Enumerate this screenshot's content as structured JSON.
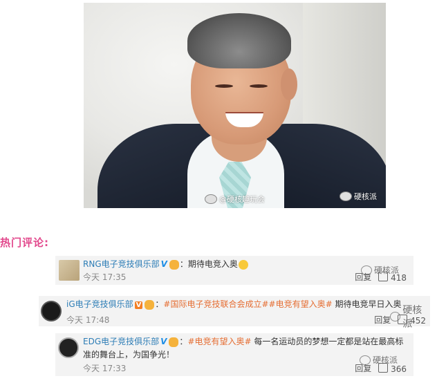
{
  "photo": {
    "watermark_left": "@硬核趣玩会",
    "watermark_right": "硬核派"
  },
  "section_title": "热门评论:",
  "comments": [
    {
      "author": "RNG电子竞技俱乐部",
      "badge": "V",
      "text": "：期待电竞入奥",
      "time": "今天 17:35",
      "reply_label": "回复",
      "likes": "418",
      "watermark": "硬核派"
    },
    {
      "author": "iG电子竞技俱乐部",
      "badge": "V",
      "hashtags": [
        "#国际电子竞技联合会成立#",
        "#电竞有望入奥#"
      ],
      "text": " 期待电竞早日入奥",
      "time": "今天 17:48",
      "reply_label": "回复",
      "likes": "452",
      "watermark": "硬核派"
    },
    {
      "author": "EDG电子竞技俱乐部",
      "badge": "V",
      "hashtag": "#电竞有望入奥#",
      "text_line1": " 每一名运动员的梦想一定都是站在最高标",
      "text_line2": "准的舞台上，为国争光！",
      "time": "今天 17:33",
      "reply_label": "回复",
      "likes": "366",
      "watermark": "硬核派"
    }
  ],
  "colors": {
    "title": "#e2488c",
    "name": "#2d7db6",
    "hashtag": "#e56d32",
    "card_bg": "#f3f3f3"
  }
}
